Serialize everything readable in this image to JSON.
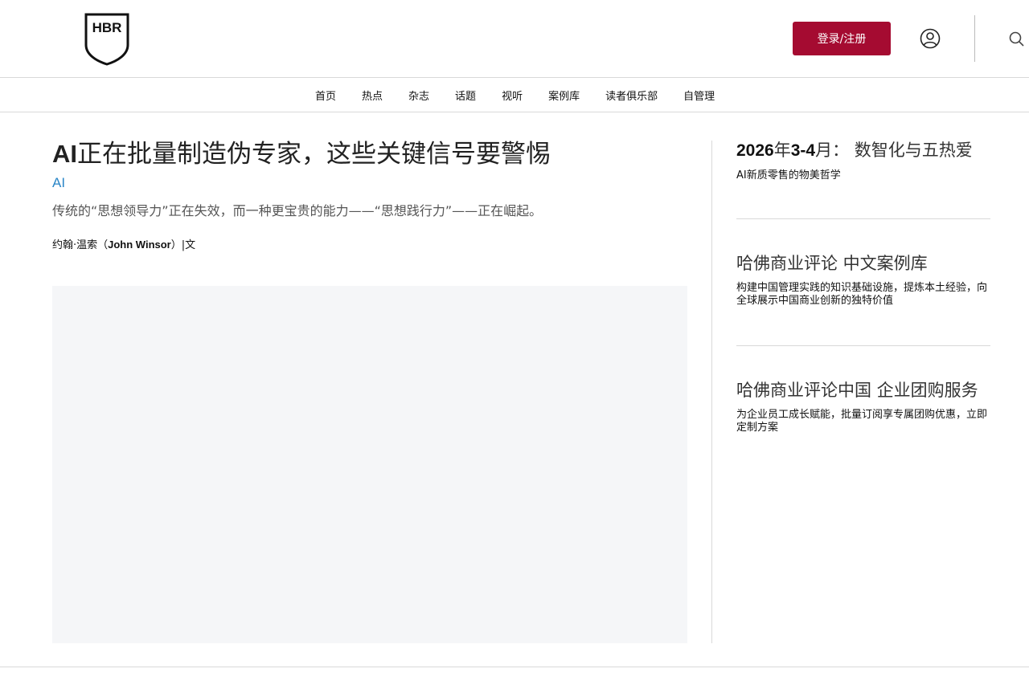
{
  "header": {
    "logo_text": "HBR",
    "login_label": "登录/注册"
  },
  "nav": {
    "items": [
      "首页",
      "热点",
      "杂志",
      "话题",
      "视听",
      "案例库",
      "读者俱乐部",
      "自管理"
    ]
  },
  "article": {
    "title_ai": "AI",
    "title_rest": "正在批量制造伪专家，这些关键信号要警惕",
    "tag": "AI",
    "summary": "传统的“思想领导力”正在失效，而一种更宝贵的能力——“思想践行力”——正在崛起。",
    "author_cn": "约翰·温索（",
    "author_en": "John Winsor",
    "author_suffix": "）|文"
  },
  "sidebar": {
    "promo1": {
      "year": "2026",
      "year_suffix": "年",
      "months": "3-4",
      "months_suffix": "月：",
      "subject": "数智化与五热爱",
      "desc": "AI新质零售的物美哲学"
    },
    "promo2": {
      "title": "哈佛商业评论 中文案例库",
      "desc": "构建中国管理实践的知识基础设施，提炼本土经验，向全球展示中国商业创新的独特价值"
    },
    "promo3": {
      "title": "哈佛商业评论中国 企业团购服务",
      "desc": "为企业员工成长赋能，批量订阅享专属团购优惠，立即定制方案"
    }
  },
  "colors": {
    "brand_red": "#a50b31",
    "tag_blue": "#2a86c7",
    "hero_bg": "#f5f6f8"
  }
}
